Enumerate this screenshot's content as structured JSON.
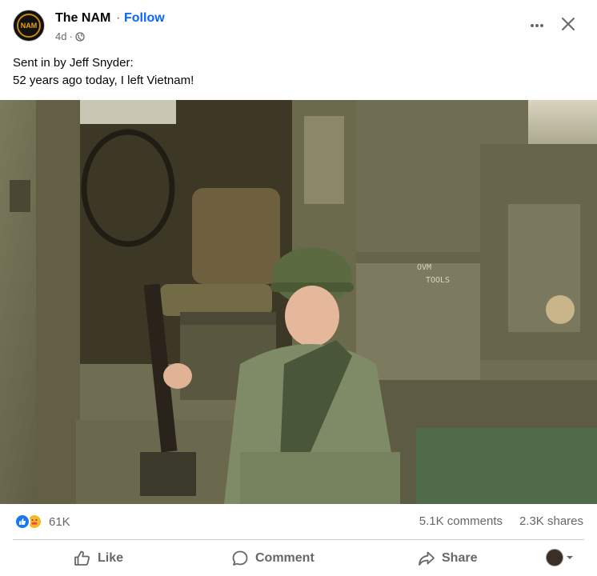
{
  "header": {
    "page_name": "The NAM",
    "separator": "·",
    "follow_label": "Follow",
    "time": "4d",
    "meta_separator": "·",
    "privacy_icon": "globe-icon",
    "avatar_text": "NAM"
  },
  "post": {
    "line1": "Sent in by Jeff Snyder:",
    "line2": "52 years ago today, I left Vietnam!"
  },
  "photo": {
    "stencil_line1": "OVM",
    "stencil_line2": "TOOLS"
  },
  "stats": {
    "reaction_icons": [
      "like-icon",
      "care-icon"
    ],
    "reaction_count": "61K",
    "comments": "5.1K comments",
    "shares": "2.3K shares"
  },
  "actions": {
    "like": "Like",
    "comment": "Comment",
    "share": "Share"
  },
  "colors": {
    "accent": "#0866ff",
    "secondary_text": "#65676b",
    "divider": "#ced0d4"
  }
}
